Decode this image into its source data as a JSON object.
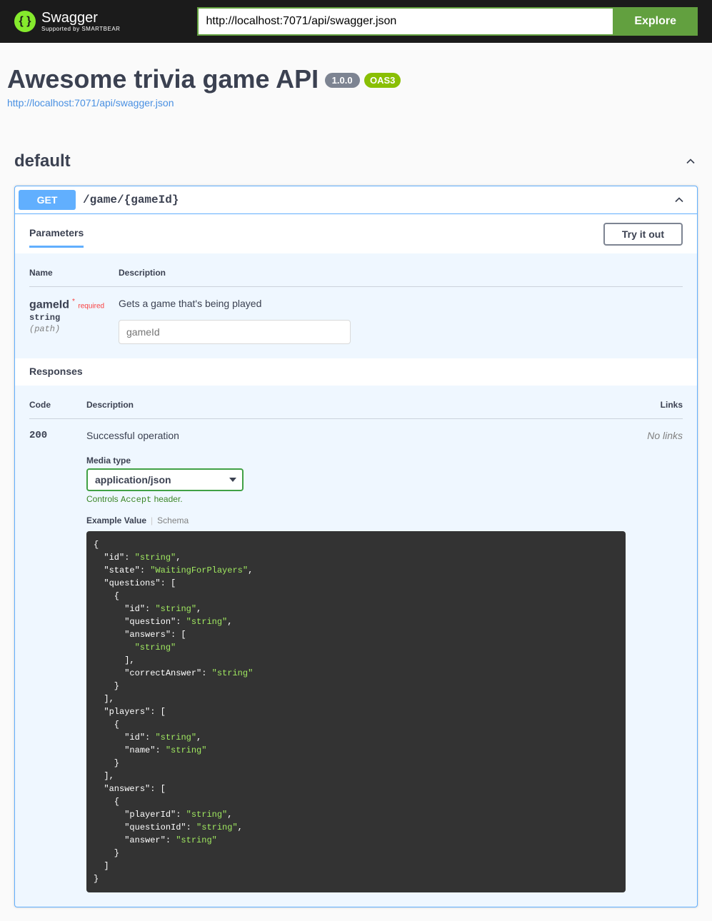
{
  "topbar": {
    "logo_text": "Swagger",
    "logo_sub": "Supported by SMARTBEAR",
    "url": "http://localhost:7071/api/swagger.json",
    "explore_label": "Explore"
  },
  "info": {
    "title": "Awesome trivia game API",
    "version": "1.0.0",
    "oas": "OAS3",
    "spec_url": "http://localhost:7071/api/swagger.json"
  },
  "tag": {
    "name": "default"
  },
  "operation": {
    "method": "GET",
    "path": "/game/{gameId}",
    "parameters_label": "Parameters",
    "try_label": "Try it out",
    "col_name": "Name",
    "col_desc": "Description",
    "param_name": "gameId",
    "required_label": "required",
    "param_type": "string",
    "param_in": "(path)",
    "param_desc": "Gets a game that's being played",
    "param_placeholder": "gameId",
    "responses_label": "Responses",
    "col_code": "Code",
    "col_resp_desc": "Description",
    "col_links": "Links",
    "resp_code": "200",
    "resp_desc": "Successful operation",
    "no_links": "No links",
    "media_label": "Media type",
    "media_value": "application/json",
    "accept_hint_prefix": "Controls ",
    "accept_hint_mono": "Accept",
    "accept_hint_suffix": " header.",
    "example_value_tab": "Example Value",
    "schema_tab": "Schema"
  },
  "example_json": {
    "lines": [
      {
        "indent": 0,
        "text": "{"
      },
      {
        "indent": 1,
        "key": "\"id\"",
        "sep": ": ",
        "val": "\"string\"",
        "trail": ","
      },
      {
        "indent": 1,
        "key": "\"state\"",
        "sep": ": ",
        "val": "\"WaitingForPlayers\"",
        "trail": ","
      },
      {
        "indent": 1,
        "key": "\"questions\"",
        "sep": ": [",
        "trail": ""
      },
      {
        "indent": 2,
        "text": "{"
      },
      {
        "indent": 3,
        "key": "\"id\"",
        "sep": ": ",
        "val": "\"string\"",
        "trail": ","
      },
      {
        "indent": 3,
        "key": "\"question\"",
        "sep": ": ",
        "val": "\"string\"",
        "trail": ","
      },
      {
        "indent": 3,
        "key": "\"answers\"",
        "sep": ": [",
        "trail": ""
      },
      {
        "indent": 4,
        "val": "\"string\"",
        "trail": ""
      },
      {
        "indent": 3,
        "text": "],"
      },
      {
        "indent": 3,
        "key": "\"correctAnswer\"",
        "sep": ": ",
        "val": "\"string\"",
        "trail": ""
      },
      {
        "indent": 2,
        "text": "}"
      },
      {
        "indent": 1,
        "text": "],"
      },
      {
        "indent": 1,
        "key": "\"players\"",
        "sep": ": [",
        "trail": ""
      },
      {
        "indent": 2,
        "text": "{"
      },
      {
        "indent": 3,
        "key": "\"id\"",
        "sep": ": ",
        "val": "\"string\"",
        "trail": ","
      },
      {
        "indent": 3,
        "key": "\"name\"",
        "sep": ": ",
        "val": "\"string\"",
        "trail": ""
      },
      {
        "indent": 2,
        "text": "}"
      },
      {
        "indent": 1,
        "text": "],"
      },
      {
        "indent": 1,
        "key": "\"answers\"",
        "sep": ": [",
        "trail": ""
      },
      {
        "indent": 2,
        "text": "{"
      },
      {
        "indent": 3,
        "key": "\"playerId\"",
        "sep": ": ",
        "val": "\"string\"",
        "trail": ","
      },
      {
        "indent": 3,
        "key": "\"questionId\"",
        "sep": ": ",
        "val": "\"string\"",
        "trail": ","
      },
      {
        "indent": 3,
        "key": "\"answer\"",
        "sep": ": ",
        "val": "\"string\"",
        "trail": ""
      },
      {
        "indent": 2,
        "text": "}"
      },
      {
        "indent": 1,
        "text": "]"
      },
      {
        "indent": 0,
        "text": "}"
      }
    ]
  }
}
